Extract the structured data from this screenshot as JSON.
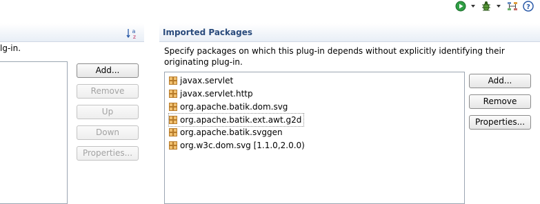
{
  "toolbar": {
    "icons": [
      "run-icon",
      "debug-icon",
      "organize-icon",
      "help-icon"
    ]
  },
  "left": {
    "description": "lg-in.",
    "sort_icon": "sort-alpha-icon",
    "buttons": {
      "add": "Add...",
      "remove": "Remove",
      "up": "Up",
      "down": "Down",
      "properties": "Properties..."
    }
  },
  "imported_packages": {
    "title": "Imported Packages",
    "description": "Specify packages on which this plug-in depends without explicitly identifying their originating plug-in.",
    "items": [
      "javax.servlet",
      "javax.servlet.http",
      "org.apache.batik.dom.svg",
      "org.apache.batik.ext.awt.g2d",
      "org.apache.batik.svggen",
      "org.w3c.dom.svg [1.1.0,2.0.0)"
    ],
    "selected_index": 3,
    "buttons": {
      "add": "Add...",
      "remove": "Remove",
      "properties": "Properties..."
    }
  },
  "colors": {
    "title": "#2a4b7c",
    "disabled_text": "#a2a2a2"
  }
}
